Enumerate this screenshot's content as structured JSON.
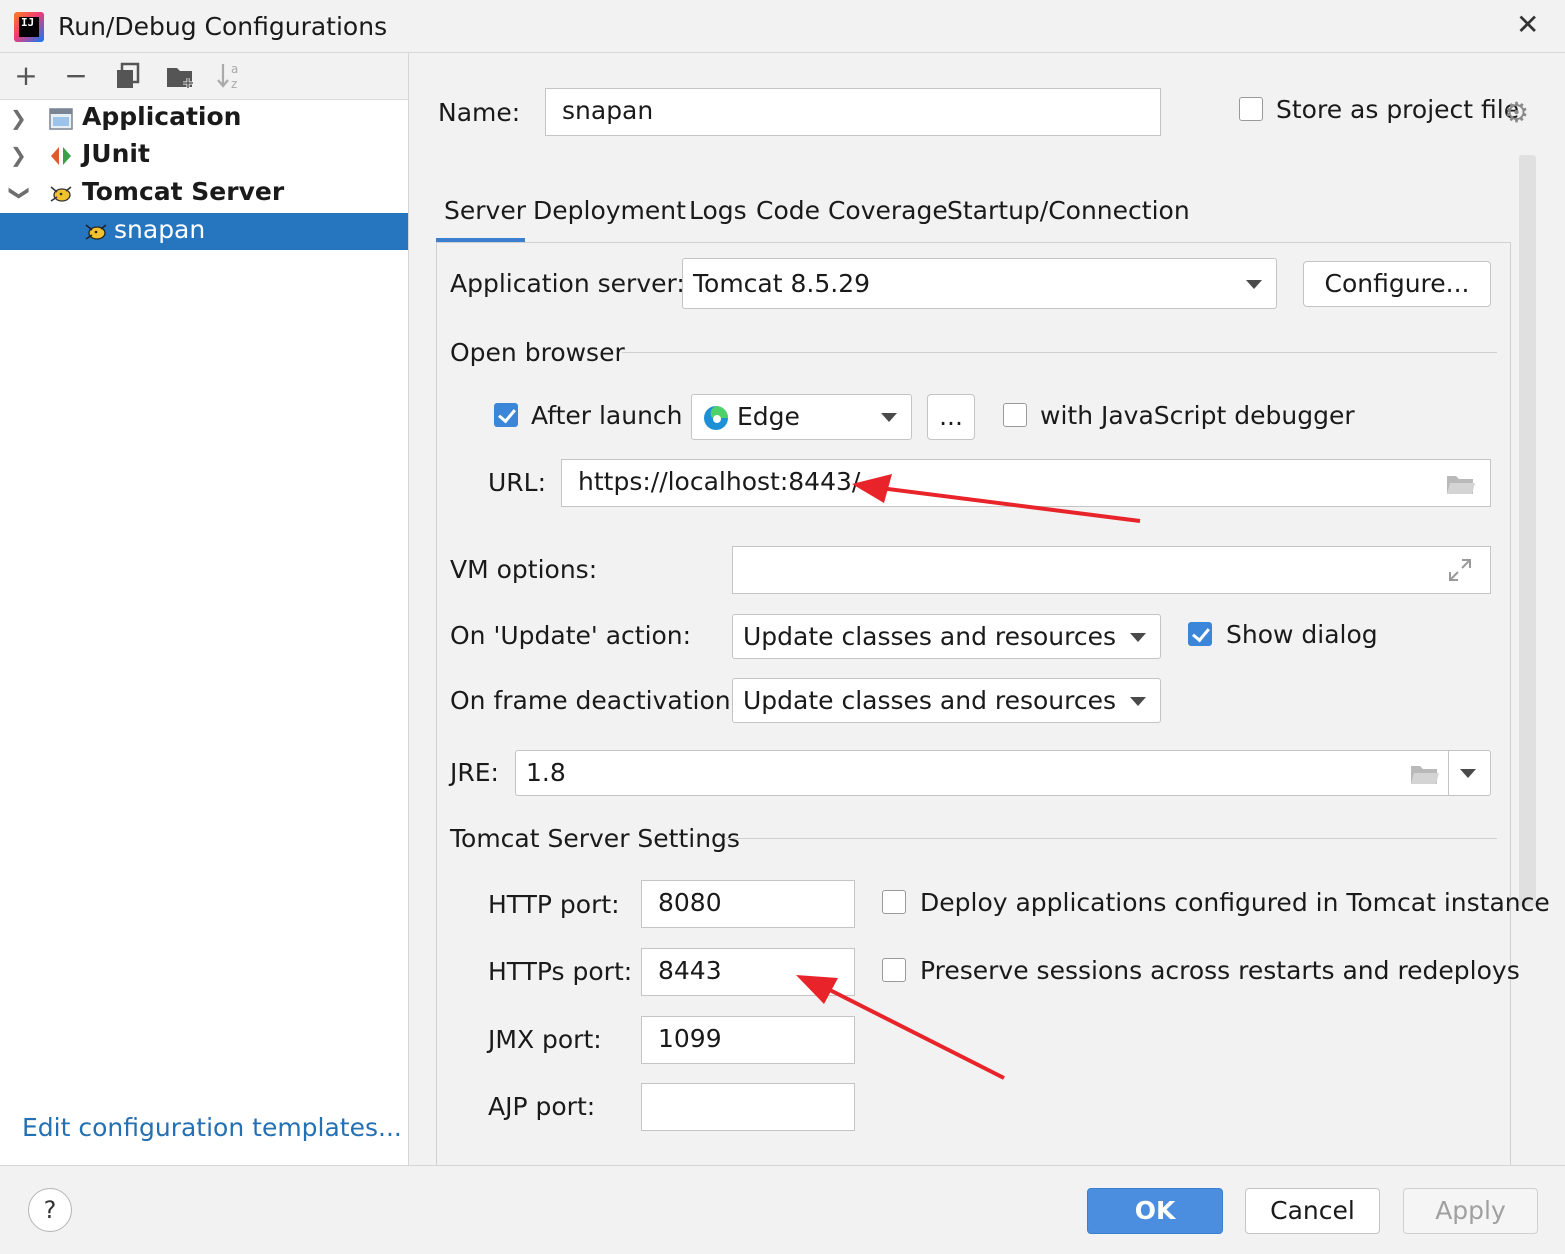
{
  "window": {
    "title": "Run/Debug Configurations"
  },
  "toolbar": {
    "add": "+",
    "remove": "−"
  },
  "tree": {
    "items": [
      {
        "label": "Application"
      },
      {
        "label": "JUnit"
      },
      {
        "label": "Tomcat Server"
      },
      {
        "label": "snapan"
      }
    ]
  },
  "left": {
    "edit_templates": "Edit configuration templates..."
  },
  "name": {
    "label": "Name:",
    "value": "snapan"
  },
  "store_project": {
    "label": "Store as project file",
    "checked": false
  },
  "tabs": [
    "Server",
    "Deployment",
    "Logs",
    "Code Coverage",
    "Startup/Connection"
  ],
  "server": {
    "app_server_label": "Application server:",
    "app_server_value": "Tomcat 8.5.29",
    "configure_label": "Configure...",
    "open_browser_label": "Open browser",
    "after_launch_label": "After launch",
    "after_launch_checked": true,
    "browser_value": "Edge",
    "ellipsis_label": "...",
    "js_debugger_label": "with JavaScript debugger",
    "js_debugger_checked": false,
    "url_label": "URL:",
    "url_value": "https://localhost:8443/",
    "vm_options_label": "VM options:",
    "vm_options_value": "",
    "on_update_label": "On 'Update' action:",
    "on_update_value": "Update classes and resources",
    "show_dialog_label": "Show dialog",
    "show_dialog_checked": true,
    "on_frame_label": "On frame deactivation:",
    "on_frame_value": "Update classes and resources",
    "jre_label": "JRE:",
    "jre_value": "1.8",
    "tomcat_settings_label": "Tomcat Server Settings",
    "http_port_label": "HTTP port:",
    "http_port_value": "8080",
    "https_port_label": "HTTPs port:",
    "https_port_value": "8443",
    "jmx_port_label": "JMX port:",
    "jmx_port_value": "1099",
    "ajp_port_label": "AJP port:",
    "ajp_port_value": "",
    "deploy_apps_label": "Deploy applications configured in Tomcat instance",
    "deploy_apps_checked": false,
    "preserve_sessions_label": "Preserve sessions across restarts and redeploys",
    "preserve_sessions_checked": false
  },
  "buttons": {
    "help": "?",
    "ok": "OK",
    "cancel": "Cancel",
    "apply": "Apply"
  },
  "colors": {
    "accent": "#4b8ee0",
    "selection": "#2675bf",
    "annotation_arrow": "#e8242a",
    "link": "#2470b3"
  }
}
